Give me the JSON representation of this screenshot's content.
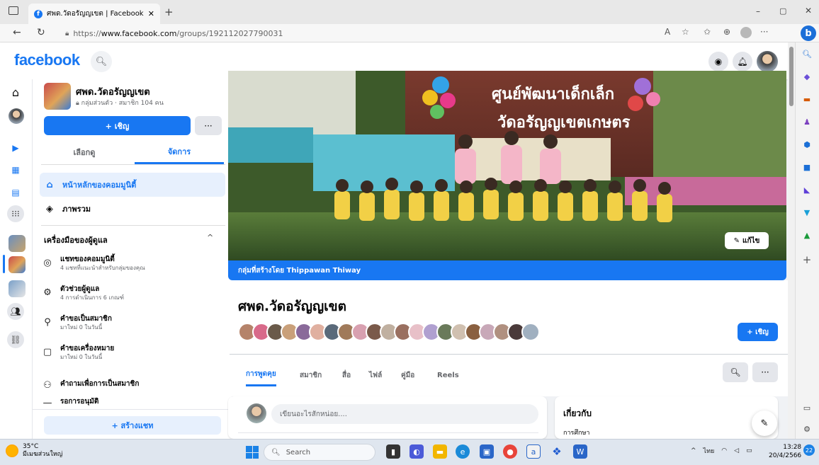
{
  "browser": {
    "tab_title": "ศพด.วัดอรัญญเขต | Facebook",
    "url_prefix": "https://",
    "url_host": "www.facebook.com",
    "url_path": "/groups/192112027790031"
  },
  "fb": {
    "logo": "facebook"
  },
  "group": {
    "name": "ศพด.วัดอรัญญเขต",
    "meta": "กลุ่มส่วนตัว · สมาชิก 104 คน",
    "invite_label": "+ เชิญ",
    "more_label": "···",
    "panel_tabs": [
      "เลือกดู",
      "จัดการ"
    ],
    "nav": [
      {
        "label": "หน้าหลักของคอมมูนิตี้",
        "icon": "home-icon"
      },
      {
        "label": "ภาพรวม",
        "icon": "overview-icon"
      }
    ],
    "tools_heading": "เครื่องมือของผู้ดูแล",
    "tools": [
      {
        "title": "แชทของคอมมูนิตี้",
        "sub": "4 แชทที่แนะนำสำหรับกลุ่มของคุณ"
      },
      {
        "title": "ตัวช่วยผู้ดูแล",
        "sub": "4 การดำเนินการ 6 เกณฑ์"
      },
      {
        "title": "คำขอเป็นสมาชิก",
        "sub": "มาใหม่ 0 ในวันนี้"
      },
      {
        "title": "คำขอเครื่องหมาย",
        "sub": "มาใหม่ 0 ในวันนี้"
      },
      {
        "title": "คำถามเพื่อการเป็นสมาชิก",
        "sub": ""
      },
      {
        "title": "รอการอนุมัติ",
        "sub": ""
      }
    ],
    "create_chat_label": "+ สร้างแชท",
    "cover_caption": "กลุ่มที่สร้างโดย Thippawan Thiway",
    "cover_edit_label": "แก้ไข",
    "invite_main_label": "+ เชิญ",
    "main_tabs": [
      "การพูดคุย",
      "สมาชิก",
      "สื่อ",
      "ไฟล์",
      "คู่มือ",
      "Reels"
    ],
    "composer_placeholder": "เขียนอะไรสักหน่อย....",
    "about_title": "เกี่ยวกับ",
    "about_sub": "การศึกษา"
  },
  "cover_art": {
    "sign_line1": "ศูนย์พัฒนาเด็กเล็ก",
    "sign_line2": "วัดอรัญญเขตเกษตร"
  },
  "taskbar": {
    "temp": "35°C",
    "weather": "มีเมฆส่วนใหญ่",
    "search_label": "Search",
    "lang": "ไทย",
    "time": "13:28",
    "date": "20/4/2566",
    "notif_count": "22"
  },
  "colors": {
    "brand": "#1877f2"
  }
}
